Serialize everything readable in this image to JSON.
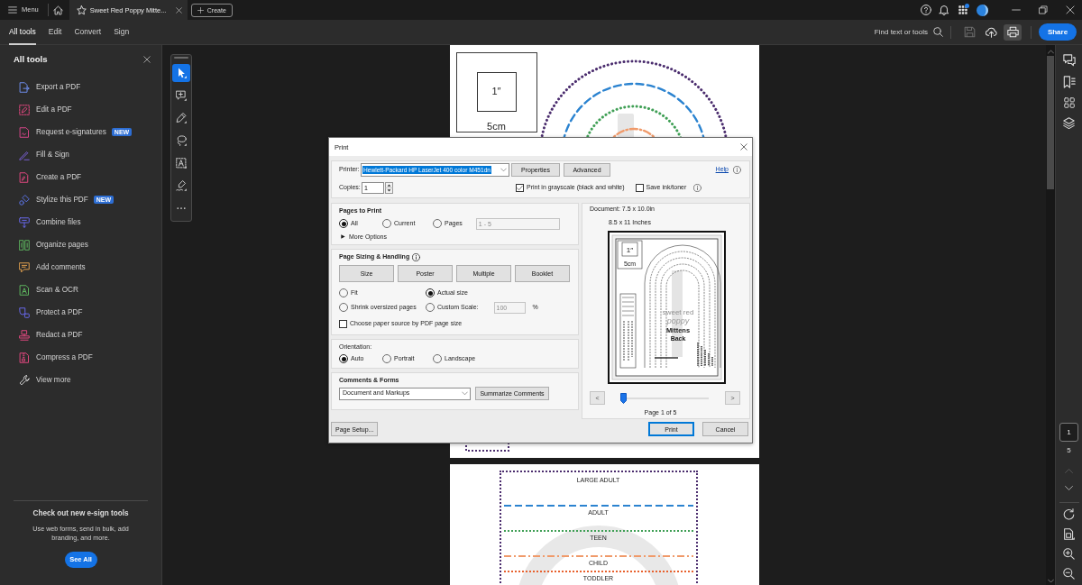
{
  "title_bar": {
    "menu_label": "Menu",
    "tab_title": "Sweet Red Poppy Mitte...",
    "create_label": "Create",
    "apps_notification": true
  },
  "toolbar": {
    "tabs": [
      {
        "label": "All tools",
        "selected": true
      },
      {
        "label": "Edit",
        "selected": false
      },
      {
        "label": "Convert",
        "selected": false
      },
      {
        "label": "Sign",
        "selected": false
      }
    ],
    "search_label": "Find text or tools",
    "actions": [
      {
        "kind": "save",
        "disabled": true,
        "selected": false
      },
      {
        "kind": "upload",
        "disabled": false,
        "selected": false
      },
      {
        "kind": "print",
        "disabled": false,
        "selected": true
      }
    ],
    "share_label": "Share"
  },
  "tools_panel": {
    "title": "All tools",
    "items": [
      {
        "label": "Export a PDF"
      },
      {
        "label": "Edit a PDF"
      },
      {
        "label": "Request e-signatures",
        "badge": "NEW"
      },
      {
        "label": "Fill & Sign"
      },
      {
        "label": "Create a PDF"
      },
      {
        "label": "Stylize this PDF",
        "badge": "NEW"
      },
      {
        "label": "Combine files"
      },
      {
        "label": "Organize pages"
      },
      {
        "label": "Add comments"
      },
      {
        "label": "Scan & OCR"
      },
      {
        "label": "Protect a PDF"
      },
      {
        "label": "Redact a PDF"
      },
      {
        "label": "Compress a PDF"
      }
    ],
    "view_more": "View more",
    "promo": {
      "title": "Check out new e-sign tools",
      "text": "Use web forms, send in bulk, add branding, and more.",
      "button": "See All"
    }
  },
  "quick_tools": [
    {
      "kind": "select",
      "selected": true
    },
    {
      "kind": "comment",
      "selected": false
    },
    {
      "kind": "draw",
      "selected": false
    },
    {
      "kind": "lasso",
      "selected": false
    },
    {
      "kind": "text",
      "selected": false
    },
    {
      "kind": "sign",
      "selected": false
    },
    {
      "kind": "more",
      "selected": false
    }
  ],
  "document": {
    "page_1": {
      "scale_label": "1″",
      "scale_caption": "5cm"
    },
    "page_2": {
      "sizes": [
        {
          "label": "LARGE ADULT",
          "color": "#4b2d6e",
          "kind": "dotted"
        },
        {
          "label": "ADULT",
          "color": "#2b83d0",
          "kind": "dashed"
        },
        {
          "label": "TEEN",
          "color": "#3f9f55",
          "kind": "dotted"
        },
        {
          "label": "CHILD",
          "color": "#f09a6a",
          "kind": "dashdot"
        },
        {
          "label": "TODDLER",
          "color": "#e8612d",
          "kind": "dotted"
        }
      ]
    }
  },
  "print_dialog": {
    "title": "Print",
    "printer": {
      "label": "Printer:",
      "value": "Hewlett-Packard HP LaserJet 400 color M451dn"
    },
    "printer_buttons": [
      "Properties",
      "Advanced"
    ],
    "help_link": "Help",
    "copies": {
      "label": "Copies:",
      "value": "1"
    },
    "print_options": [
      {
        "label": "Print in grayscale (black and white)",
        "checked": true
      },
      {
        "label": "Save ink/toner",
        "checked": false
      }
    ],
    "pages_to_print": {
      "title": "Pages to Print",
      "choices": [
        {
          "label": "All",
          "selected": true
        },
        {
          "label": "Current",
          "selected": false
        },
        {
          "label": "Pages",
          "selected": false
        }
      ],
      "range": "1 - 5",
      "range_disabled": true,
      "more_options": "More Options"
    },
    "page_sizing": {
      "title": "Page Sizing & Handling",
      "modes": [
        "Size",
        "Poster",
        "Multiple",
        "Booklet"
      ],
      "scaling": [
        {
          "label": "Fit",
          "selected": false
        },
        {
          "label": "Actual size",
          "selected": true
        },
        {
          "label": "Shrink oversized pages",
          "selected": false
        },
        {
          "label": "Custom Scale:",
          "selected": false
        }
      ],
      "scale_value": "100",
      "scale_disabled": true,
      "scale_unit": "%",
      "paper_source": {
        "label": "Choose paper source by PDF page size",
        "checked": false
      }
    },
    "orientation": {
      "title": "Orientation:",
      "choices": [
        {
          "label": "Auto",
          "selected": true
        },
        {
          "label": "Portrait",
          "selected": false
        },
        {
          "label": "Landscape",
          "selected": false
        }
      ]
    },
    "comments_forms": {
      "title": "Comments & Forms",
      "value": "Document and Markups",
      "button": "Summarize Comments"
    },
    "preview": {
      "document_size": "Document: 7.5 x 10.0in",
      "paper_size": "8.5 x 11 Inches",
      "thumbnail": {
        "scale_label": "1″",
        "scale_caption": "5cm",
        "brand_top": "sweet red",
        "brand_bottom": "poppy",
        "title": "Mittens",
        "piece": "Back"
      },
      "previous": "<",
      "next": ">",
      "level": 0,
      "page_label": "Page 1 of 5"
    },
    "footer": {
      "page_setup": "Page Setup...",
      "print": "Print",
      "cancel": "Cancel"
    }
  },
  "page_nav": {
    "current": "1",
    "total": "5",
    "previous_disabled": true,
    "next_disabled": false
  }
}
